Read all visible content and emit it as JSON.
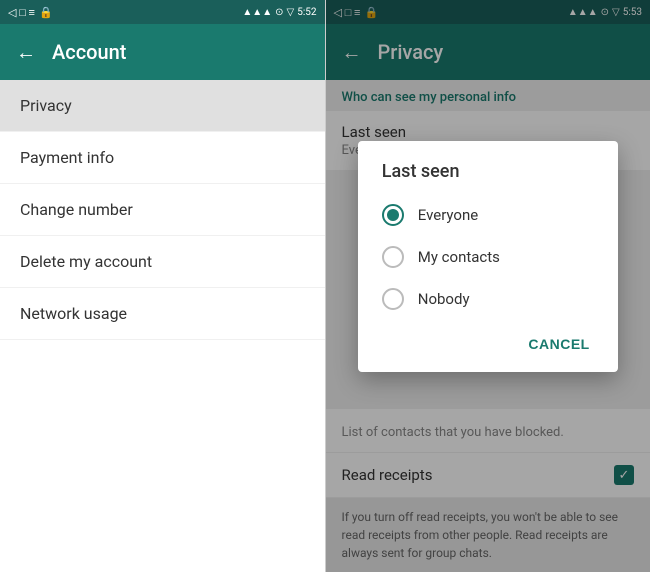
{
  "left": {
    "status_bar": {
      "left_icons": "◁  □  ≡  🔒",
      "time": "5:52",
      "right_icons": "📶 4G▲"
    },
    "top_bar": {
      "back_arrow": "←",
      "title": "Account"
    },
    "menu_items": [
      {
        "label": "Privacy",
        "highlighted": true
      },
      {
        "label": "Payment info"
      },
      {
        "label": "Change number"
      },
      {
        "label": "Delete my account"
      },
      {
        "label": "Network usage"
      }
    ]
  },
  "right": {
    "status_bar": {
      "left_icons": "◁  □  ≡  🔒",
      "time": "5:53",
      "right_icons": "📶 4G▲"
    },
    "top_bar": {
      "back_arrow": "←",
      "title": "Privacy"
    },
    "section_header": "Who can see my personal info",
    "last_seen_row": {
      "title": "Last seen",
      "value": "Everyone"
    },
    "dialog": {
      "title": "Last seen",
      "options": [
        {
          "label": "Everyone",
          "selected": true
        },
        {
          "label": "My contacts",
          "selected": false
        },
        {
          "label": "Nobody",
          "selected": false
        }
      ],
      "cancel_label": "CANCEL"
    },
    "blocked_text": "List of contacts that you have blocked.",
    "read_receipts": {
      "title": "Read receipts",
      "checked": true
    },
    "receipts_description": "If you turn off read receipts, you won't be able to see read receipts from other people. Read receipts are always sent for group chats."
  }
}
